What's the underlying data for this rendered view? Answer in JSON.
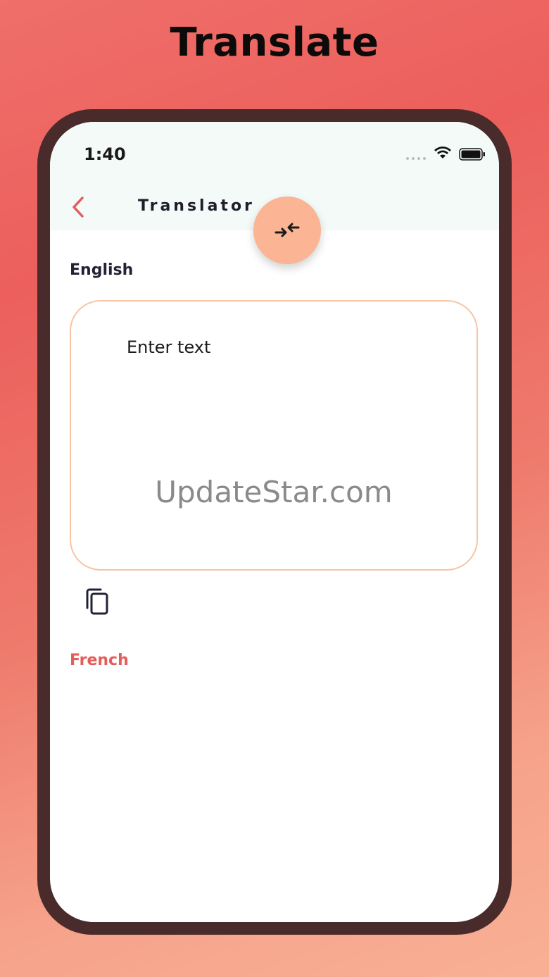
{
  "headline": "Translate",
  "status_bar": {
    "time": "1:40"
  },
  "header": {
    "title": "Translator"
  },
  "source_language": "English",
  "input": {
    "placeholder": "Enter text"
  },
  "watermark": "UpdateStar.com",
  "target_language": "French",
  "colors": {
    "accent": "#e35d5a",
    "swap_button": "#fbb494",
    "input_border": "#f8c4a4",
    "phone_frame": "#4a2b2b"
  },
  "icons": {
    "back": "chevron-left-icon",
    "swap": "swap-arrows-icon",
    "copy": "copy-icon"
  }
}
